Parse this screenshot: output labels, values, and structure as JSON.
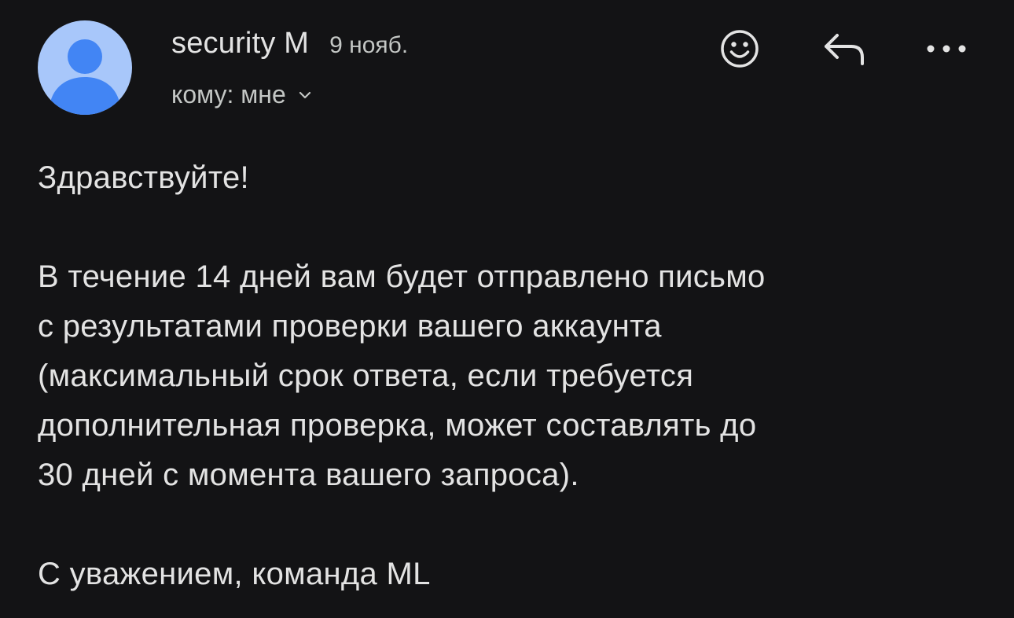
{
  "sender": {
    "name": "security M",
    "date": "9 нояб.",
    "recipient_label": "кому: мне"
  },
  "icons": {
    "avatar": "person-avatar",
    "recipient_toggle": "chevron-down-icon",
    "emoji": "emoji-icon",
    "reply": "reply-icon",
    "more": "more-horiz-icon"
  },
  "colors": {
    "background": "#131315",
    "avatar_bg": "#a8c7fa",
    "avatar_fg": "#4285f4",
    "text": "#e3e3e3",
    "muted": "#c4c7c5"
  },
  "message": {
    "greeting": "Здравствуйте!",
    "body_lines": [
      "В течение 14 дней вам будет отправлено письмо",
      "с результатами проверки вашего аккаунта",
      "(максимальный срок ответа, если требуется",
      "дополнительная проверка, может составлять до",
      "30 дней с момента вашего запроса)."
    ],
    "signature": "С уважением, команда ML"
  }
}
